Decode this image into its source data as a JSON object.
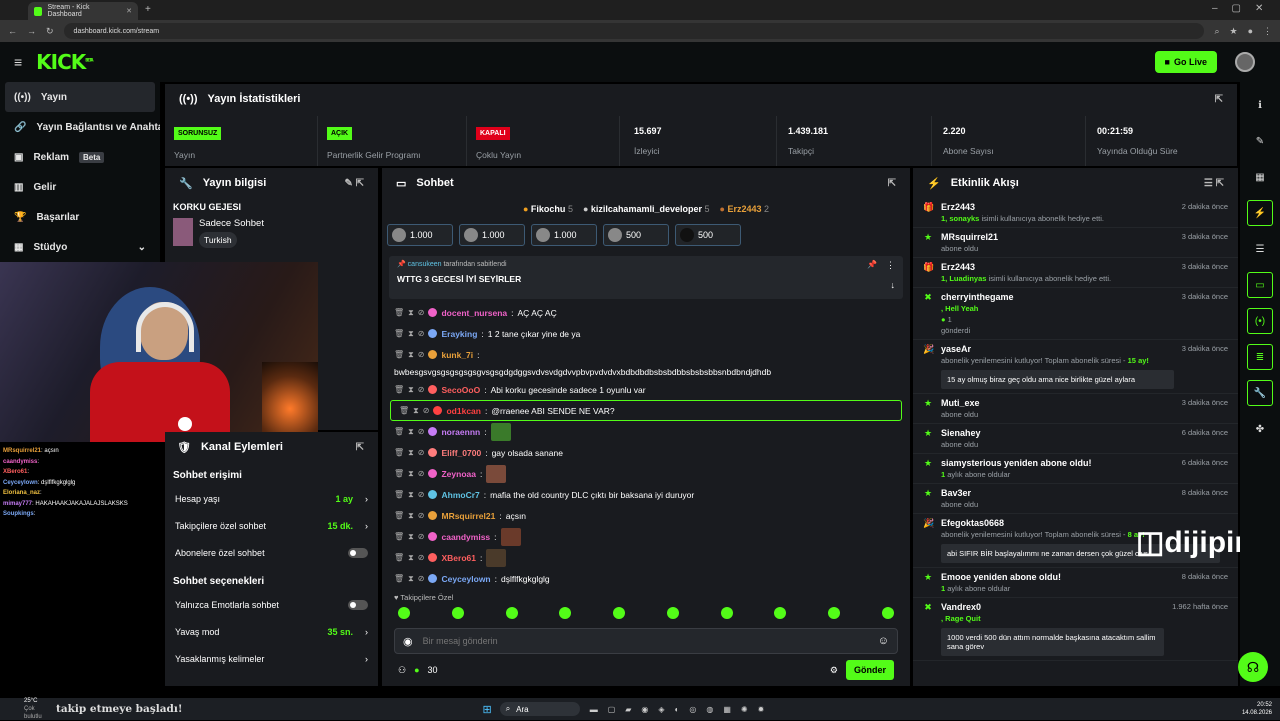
{
  "browser": {
    "tab_title": "Stream - Kick Dashboard",
    "url": "dashboard.kick.com/stream"
  },
  "header": {
    "logo": "KICK",
    "logo_sup": "BETA",
    "golive_label": "Go Live"
  },
  "sidebar": {
    "items": [
      {
        "label": "Yayın",
        "icon": "broadcast-icon"
      },
      {
        "label": "Yayın Bağlantısı ve Anahtar",
        "icon": "link-icon"
      },
      {
        "label": "Reklam",
        "icon": "ad-icon",
        "badge": "Beta"
      },
      {
        "label": "Gelir",
        "icon": "chart-icon"
      },
      {
        "label": "Başarılar",
        "icon": "trophy-icon"
      },
      {
        "label": "Stüdyo",
        "icon": "studio-icon"
      }
    ]
  },
  "stats": {
    "title": "Yayın İstatistikleri",
    "cells": [
      {
        "badge": "SORUNSUZ",
        "label": "Yayın"
      },
      {
        "badge": "AÇIK",
        "label": "Partnerlik Gelir Programı"
      },
      {
        "badge": "KAPALI",
        "label": "Çoklu Yayın"
      },
      {
        "value": "15.697",
        "label": "İzleyici"
      },
      {
        "value": "1.439.181",
        "label": "Takipçi"
      },
      {
        "value": "2.220",
        "label": "Abone Sayısı"
      },
      {
        "value": "00:21:59",
        "label": "Yayında Olduğu Süre"
      }
    ]
  },
  "info": {
    "title": "Yayın bilgisi",
    "stream_title": "KORKU GEJESI",
    "category": "Sadece Sohbet",
    "tag": "Turkish"
  },
  "channel_actions": {
    "title": "Kanal Eylemleri",
    "access_title": "Sohbet erişimi",
    "rows": [
      {
        "label": "Hesap yaşı",
        "value": "1 ay"
      },
      {
        "label": "Takipçilere özel sohbet",
        "value": "15 dk."
      },
      {
        "label": "Abonelere özel sohbet",
        "toggle": "off"
      }
    ],
    "options_title": "Sohbet seçenekleri",
    "rows2": [
      {
        "label": "Yalnızca Emotlarla sohbet",
        "toggle": "off"
      },
      {
        "label": "Yavaş mod",
        "value": "35 sn."
      },
      {
        "label": "Yasaklanmış kelimeler"
      }
    ]
  },
  "chat": {
    "title": "Sohbet",
    "top_gifters": [
      {
        "name": "Fikochu",
        "count": "5"
      },
      {
        "name": "kizilcahamamli_developer",
        "count": "5"
      },
      {
        "name": "Erz2443",
        "count": "2"
      }
    ],
    "gifts": [
      "1.000",
      "1.000",
      "1.000",
      "500",
      "500"
    ],
    "pinned_by": "cansukeen",
    "pinned_suffix": "tarafından sabitlendi",
    "pinned_text": "WTTG 3 GECESİ İYİ SEYİRLER",
    "messages": [
      {
        "user": "docent_nursena",
        "text": "AÇ AÇ AÇ",
        "color": "#f062c8"
      },
      {
        "user": "Erayking",
        "text": "1 2 tane çıkar yine de ya",
        "color": "#7ba8f5"
      },
      {
        "user": "kunk_7i",
        "text": "",
        "color": "#e8a03a"
      },
      {
        "user": "",
        "text": "bwbesgsvgsgsgsgsgsgvsgsgdgdggsvdvsvdgdvvpbvpvdvdvxbdbdbdbsbsbdbbsbsbsbbsnbdbndjdhdb",
        "color": "#fff"
      },
      {
        "user": "SecoOoO",
        "text": "Abi korku gecesinde sadece 1 oyunlu var",
        "color": "#ff5f5f"
      },
      {
        "user": "od1kcan",
        "text": "@rraenee ABI SENDE NE VAR?",
        "color": "#ff4141",
        "highlight": true
      },
      {
        "user": "noraennn",
        "text": "",
        "color": "#c67cf5"
      },
      {
        "user": "Eliff_0700",
        "text": "gay olsada sanane",
        "color": "#ff7d7d"
      },
      {
        "user": "Zeynoaa",
        "text": "",
        "color": "#f062c8"
      },
      {
        "user": "AhmoCr7",
        "text": "mafia the old country DLC çıktı bir baksana iyi duruyor",
        "color": "#5fc3e4"
      },
      {
        "user": "MRsquirrel21",
        "text": "açsın",
        "color": "#e8a03a"
      },
      {
        "user": "caandymiss",
        "text": "",
        "color": "#f062c8"
      },
      {
        "user": "XBero61",
        "text": "",
        "color": "#ff5f5f"
      },
      {
        "user": "Ceyceylown",
        "text": "dşlflfkgkglglg",
        "color": "#7ba8f5"
      }
    ],
    "followers_only": "Takipçilere Özel",
    "placeholder": "Bir mesaj gönderin",
    "points": "30",
    "send_label": "Gönder"
  },
  "events": {
    "title": "Etkinlik Akışı",
    "items": [
      {
        "name": "Erz2443",
        "sub_bold": "1, sonayks",
        "sub": "isimli kullanıcıya abonelik hediye etti.",
        "time": "2 dakika önce",
        "icon": "gift-icon"
      },
      {
        "name": "MRsquirrel21",
        "sub": "abone oldu",
        "time": "3 dakika önce",
        "icon": "sub-icon"
      },
      {
        "name": "Erz2443",
        "sub_bold": "1, Luadinyas",
        "sub": "isimli kullanıcıya abonelik hediye etti.",
        "time": "3 dakika önce",
        "icon": "gift-icon"
      },
      {
        "name": "cherryinthegame",
        "sub_bold": ", Hell Yeah",
        "sub2": "1",
        "sub3": "gönderdi",
        "time": "3 dakika önce",
        "icon": "kick-icon"
      },
      {
        "name": "yaseAr",
        "sub": "abonelik yenilemesini kutluyor! Toplam abonelik süresi -",
        "sub_green": "15 ay!",
        "quote": "15 ay olmuş biraz geç oldu ama nice birlikte güzel aylara",
        "time": "3 dakika önce",
        "icon": "renew-icon"
      },
      {
        "name": "Muti_exe",
        "sub": "abone oldu",
        "time": "3 dakika önce",
        "icon": "sub-icon"
      },
      {
        "name": "Sienahey",
        "sub": "abone oldu",
        "time": "6 dakika önce",
        "icon": "sub-icon"
      },
      {
        "name": "siamysterious yeniden abone oldu!",
        "sub_bold": "1",
        "sub": "aylık abone oldular",
        "time": "6 dakika önce",
        "icon": "sub-icon"
      },
      {
        "name": "Bav3er",
        "sub": "abone oldu",
        "time": "8 dakika önce",
        "icon": "sub-icon"
      },
      {
        "name": "Efegoktas0668",
        "sub": "abonelik yenilemesini kutluyor! Toplam abonelik süresi -",
        "sub_green": "8 ay!",
        "quote": "abi SIFIR BİR başlayalımmı ne zaman dersen çok güzel olur",
        "time": "",
        "icon": "renew-icon"
      },
      {
        "name": "Emooe yeniden abone oldu!",
        "sub_bold": "1",
        "sub": "aylık abone oldular",
        "time": "8 dakika önce",
        "icon": "sub-icon"
      },
      {
        "name": "Vandrex0",
        "sub_bold": ", Rage Quit",
        "quote": "1000 verdi 500 dün attım normalde başkasına atacaktım sallim sana görev",
        "time": "1.962 hafta önce",
        "icon": "kick-icon"
      }
    ]
  },
  "overlay_chat": [
    {
      "user": "MRsquirrel21",
      "text": "açsın",
      "color": "#e8a03a"
    },
    {
      "user": "caandymiss",
      "text": "",
      "color": "#f062c8"
    },
    {
      "user": "XBero61",
      "text": "",
      "color": "#ff5f5f"
    },
    {
      "user": "Ceyceylown",
      "text": "dşlflfkgkglglg",
      "color": "#7ba8f5"
    },
    {
      "user": "Eloriana_naz",
      "text": "",
      "color": "#f0c040"
    },
    {
      "user": "mimay777",
      "text": "HAKAHAAKJAKAJALAJSLAKSKS",
      "color": "#c67cf5"
    },
    {
      "user": "Soupkings",
      "text": "",
      "color": "#7ba8f5"
    },
    {
      "user": "",
      "text": "",
      "color": "#555"
    },
    {
      "user": "",
      "text": "",
      "color": "#555"
    }
  ],
  "watermark": "dijipin",
  "taskbar": {
    "weather_temp": "25°C",
    "weather_text": "Çok bulutlu",
    "ticker": "takip etmeye başladı!",
    "search": "Ara",
    "time": "20:52",
    "date": "14.08.2026"
  }
}
